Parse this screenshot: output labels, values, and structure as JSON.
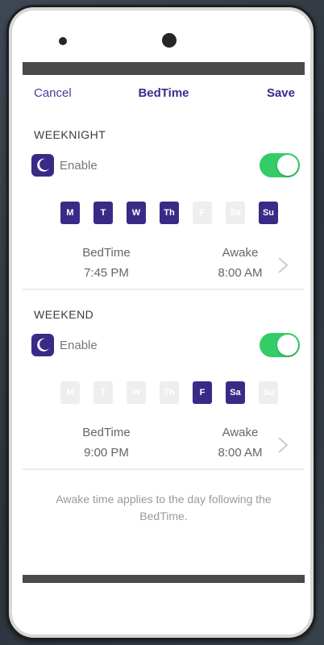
{
  "navbar": {
    "cancel_label": "Cancel",
    "title": "BedTime",
    "save_label": "Save"
  },
  "sections": [
    {
      "title": "WEEKNIGHT",
      "enable_label": "Enable",
      "enabled": true,
      "days": [
        {
          "label": "M",
          "selected": true
        },
        {
          "label": "T",
          "selected": true
        },
        {
          "label": "W",
          "selected": true
        },
        {
          "label": "Th",
          "selected": true
        },
        {
          "label": "F",
          "selected": false
        },
        {
          "label": "Sa",
          "selected": false
        },
        {
          "label": "Su",
          "selected": true
        }
      ],
      "bedtime_label": "BedTime",
      "bedtime_value": "7:45 PM",
      "awake_label": "Awake",
      "awake_value": "8:00 AM"
    },
    {
      "title": "WEEKEND",
      "enable_label": "Enable",
      "enabled": true,
      "days": [
        {
          "label": "M",
          "selected": false
        },
        {
          "label": "T",
          "selected": false
        },
        {
          "label": "W",
          "selected": false
        },
        {
          "label": "Th",
          "selected": false
        },
        {
          "label": "F",
          "selected": true
        },
        {
          "label": "Sa",
          "selected": true
        },
        {
          "label": "Su",
          "selected": false
        }
      ],
      "bedtime_label": "BedTime",
      "bedtime_value": "9:00 PM",
      "awake_label": "Awake",
      "awake_value": "8:00 AM"
    }
  ],
  "footer_note": "Awake time applies to the day following the BedTime.",
  "colors": {
    "accent": "#3a2a87",
    "toggle_on": "#33cc66",
    "day_off": "#eeeeee"
  },
  "icons": {
    "moon": "moon-icon",
    "chevron": "chevron-right-icon"
  }
}
